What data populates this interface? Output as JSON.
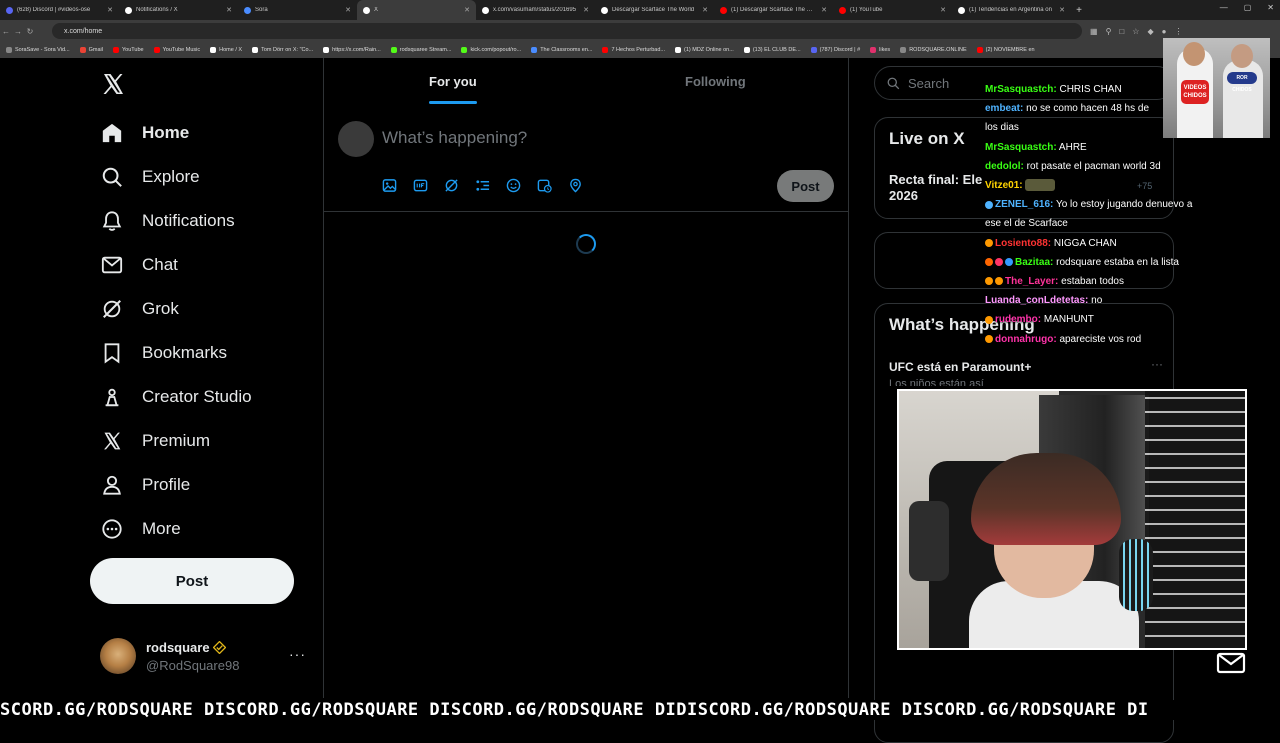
{
  "browser": {
    "tabs": [
      {
        "label": "(628) Discord | #videos-ose",
        "color": "#5865f2"
      },
      {
        "label": "Notifications / X",
        "color": "#ffffff"
      },
      {
        "label": "Sora",
        "color": "#4a8cff"
      },
      {
        "label": "X",
        "color": "#ffffff",
        "active": true
      },
      {
        "label": "x.com/vasumam/status/201695",
        "color": "#ffffff"
      },
      {
        "label": "Descargar Scarface The World",
        "color": "#ffffff"
      },
      {
        "label": "(1) Descargar Scarface The Wor",
        "color": "#ff0000"
      },
      {
        "label": "(1) YouTube",
        "color": "#ff0000"
      },
      {
        "label": "(1) Tendencias en Argentina on",
        "color": "#ffffff"
      }
    ],
    "new_tab": "+",
    "window_controls": {
      "minimize": "—",
      "maximize": "▢",
      "close": "✕"
    },
    "url": "x.com/home",
    "bookmarks": [
      {
        "label": "SoraSave - Sora Vid...",
        "color": "#888888"
      },
      {
        "label": "Gmail",
        "color": "#ea4335"
      },
      {
        "label": "YouTube",
        "color": "#ff0000"
      },
      {
        "label": "YouTube Music",
        "color": "#ff0000"
      },
      {
        "label": "Home / X",
        "color": "#ffffff"
      },
      {
        "label": "Tom Dörr on X: \"Co...",
        "color": "#ffffff"
      },
      {
        "label": "https://x.com/Rain...",
        "color": "#ffffff"
      },
      {
        "label": "rodsquaree Stream...",
        "color": "#53fc18"
      },
      {
        "label": "kick.com/popout/ro...",
        "color": "#53fc18"
      },
      {
        "label": "The Classrooms en...",
        "color": "#4a8cff"
      },
      {
        "label": "7 Hechos Perturbad...",
        "color": "#ff0000"
      },
      {
        "label": "(1) MDZ Online on...",
        "color": "#ffffff"
      },
      {
        "label": "(13) EL CLUB DE...",
        "color": "#ffffff"
      },
      {
        "label": "(787) Discord | #",
        "color": "#5865f2"
      },
      {
        "label": "likes",
        "color": "#e1306c"
      },
      {
        "label": "RODSQUARE.ONLINE",
        "color": "#888888"
      },
      {
        "label": "(2) NOVIEMBRE en",
        "color": "#ff0000"
      }
    ]
  },
  "nav": {
    "items": [
      {
        "label": "Home",
        "icon": "home-icon"
      },
      {
        "label": "Explore",
        "icon": "search-icon"
      },
      {
        "label": "Notifications",
        "icon": "bell-icon"
      },
      {
        "label": "Chat",
        "icon": "envelope-icon"
      },
      {
        "label": "Grok",
        "icon": "grok-icon"
      },
      {
        "label": "Bookmarks",
        "icon": "bookmark-icon"
      },
      {
        "label": "Creator Studio",
        "icon": "creator-studio-icon"
      },
      {
        "label": "Premium",
        "icon": "x-logo-icon"
      },
      {
        "label": "Profile",
        "icon": "person-icon"
      },
      {
        "label": "More",
        "icon": "more-circle-icon"
      }
    ],
    "post_label": "Post"
  },
  "account": {
    "name": "rodsquare",
    "handle": "@RodSquare98",
    "more": "···"
  },
  "timeline": {
    "tabs": {
      "for_you": "For you",
      "following": "Following"
    },
    "compose_placeholder": "What’s happening?",
    "post_label": "Post"
  },
  "sidebar": {
    "search_placeholder": "Search",
    "live_title": "Live on X",
    "live_event": "Recta final: Ele 2026",
    "live_count": "+75",
    "trending_title": "What’s happening",
    "trend1": "UFC está en Paramount+",
    "trend1_sub": "Los niños están así",
    "trend1_more": "···"
  },
  "chat": {
    "messages": [
      {
        "user": "MrSasquastch:",
        "text": "CHRIS CHAN",
        "color": "#39ff14",
        "badges": []
      },
      {
        "user": "embeat:",
        "text": "no se como hacen 48 hs de",
        "color": "#4fb3ff",
        "badges": []
      },
      {
        "user": "",
        "text": "los dias",
        "color": "#ffffff",
        "badges": []
      },
      {
        "user": "MrSasquastch:",
        "text": "AHRE",
        "color": "#39ff14",
        "badges": []
      },
      {
        "user": "dedolol:",
        "text": "rot pasate el pacman world 3d",
        "color": "#39ff14",
        "badges": []
      },
      {
        "user": "Vitze01:",
        "text": "",
        "color": "#ffd400",
        "badges": [],
        "emote": true
      },
      {
        "user": "ZENEL_616:",
        "text": "Yo lo estoy jugando denuevo a",
        "color": "#4fb3ff",
        "badges": [
          "#4fb3ff"
        ]
      },
      {
        "user": "",
        "text": "ese el de Scarface",
        "color": "#ffffff",
        "badges": []
      },
      {
        "user": "Losiento88:",
        "text": "NIGGA CHAN",
        "color": "#ff3333",
        "badges": [
          "#ff9900"
        ]
      },
      {
        "user": "Bazitaa:",
        "text": "rodsquare estaba en la lista",
        "color": "#39ff14",
        "badges": [
          "#ff6600",
          "#ff3366",
          "#3399ff"
        ]
      },
      {
        "user": "The_Layer:",
        "text": "estaban todos",
        "color": "#ff3399",
        "badges": [
          "#ff9900",
          "#ff9900"
        ]
      },
      {
        "user": "Luanda_conLdetetas:",
        "text": "no",
        "color": "#ff99ff",
        "badges": []
      },
      {
        "user": "rudembo:",
        "text": "MANHUNT",
        "color": "#ff33aa",
        "badges": [
          "#ff9900"
        ]
      },
      {
        "user": "donnahrugo:",
        "text": "apareciste vos rod",
        "color": "#ff33aa",
        "badges": [
          "#ff9900"
        ]
      }
    ]
  },
  "promo": {
    "badge1": "VIDEOS CHIDOS",
    "badge2": "ROR CHIDOS"
  },
  "ticker": {
    "text": "SCORD.GG/RODSQUARE DISCORD.GG/RODSQUARE DISCORD.GG/RODSQUARE DIDISCORD.GG/RODSQUARE DISCORD.GG/RODSQUARE DI"
  },
  "colors": {
    "accent": "#1d9bf0",
    "background": "#000000",
    "border": "#2f3336",
    "muted_text": "#71767b"
  }
}
